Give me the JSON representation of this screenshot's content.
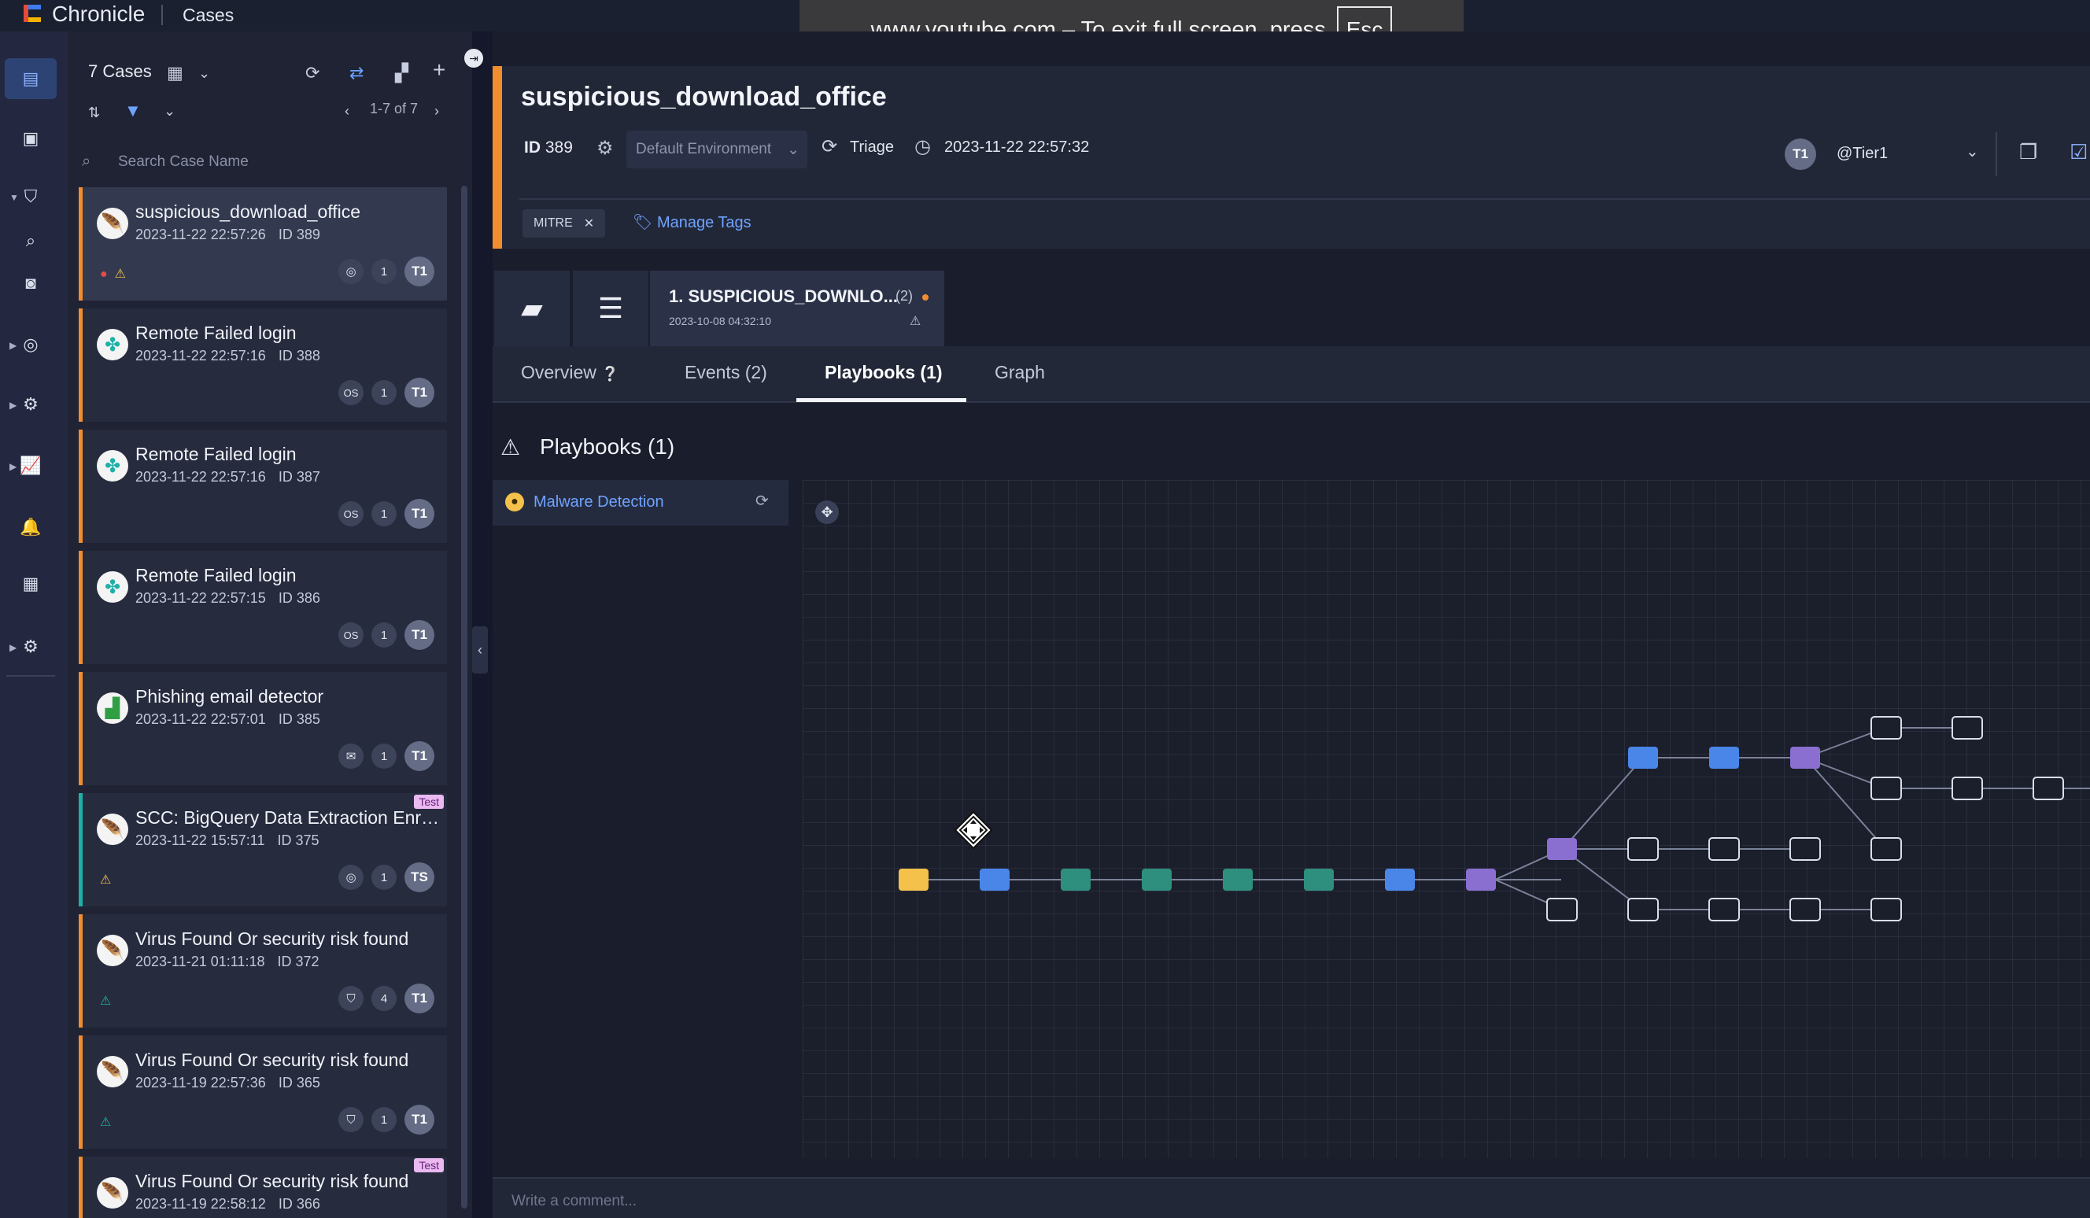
{
  "app": {
    "name": "Chronicle",
    "section": "Cases"
  },
  "browser_toast": {
    "text": "www.youtube.com – To exit full screen, press",
    "key": "Esc"
  },
  "rail": {
    "items": [
      "cases-icon",
      "briefcase-icon",
      "shield-icon",
      "search-icon",
      "camera-icon",
      "radar-icon",
      "gear-icon",
      "chart-icon",
      "bell-icon",
      "store-icon",
      "settings-icon"
    ]
  },
  "case_list": {
    "count_label": "7 Cases",
    "pager": "1-7 of 7",
    "search_placeholder": "Search Case Name",
    "cases": [
      {
        "title": "suspicious_download_office",
        "time": "2023-11-22 22:57:26",
        "id": "ID 389",
        "badge_mid": "1",
        "tier": "T1",
        "selected": true
      },
      {
        "title": "Remote Failed login",
        "time": "2023-11-22 22:57:16",
        "id": "ID 388",
        "badge_os": "OS",
        "badge_mid": "1",
        "tier": "T1"
      },
      {
        "title": "Remote Failed login",
        "time": "2023-11-22 22:57:16",
        "id": "ID 387",
        "badge_os": "OS",
        "badge_mid": "1",
        "tier": "T1"
      },
      {
        "title": "Remote Failed login",
        "time": "2023-11-22 22:57:15",
        "id": "ID 386",
        "badge_os": "OS",
        "badge_mid": "1",
        "tier": "T1"
      },
      {
        "title": "Phishing email detector",
        "time": "2023-11-22 22:57:01",
        "id": "ID 385",
        "badge_mid": "1",
        "tier": "T1"
      },
      {
        "title": "SCC: BigQuery Data Extraction Enrichment",
        "time": "2023-11-22 15:57:11",
        "id": "ID 375",
        "badge_mid": "1",
        "tier": "TS",
        "test": "Test"
      },
      {
        "title": "Virus Found Or security risk found",
        "time": "2023-11-21 01:11:18",
        "id": "ID 372",
        "badge_mid": "4",
        "tier": "T1"
      },
      {
        "title": "Virus Found Or security risk found",
        "time": "2023-11-19 22:57:36",
        "id": "ID 365",
        "badge_mid": "1",
        "tier": "T1"
      },
      {
        "title": "Virus Found Or security risk found",
        "time": "2023-11-19 22:58:12",
        "id": "ID 366",
        "test": "Test"
      }
    ]
  },
  "case": {
    "name": "suspicious_download_office",
    "id_label": "ID",
    "id_value": "389",
    "environment": "Default Environment",
    "stage": "Triage",
    "time": "2023-11-22 22:57:32",
    "assignee_avatar": "T1",
    "assignee": "@Tier1",
    "tag": "MITRE",
    "manage_tags": "Manage Tags"
  },
  "alert": {
    "title": "1. SUSPICIOUS_DOWNLO...",
    "count": "(2)",
    "time": "2023-10-08 04:32:10"
  },
  "tabs": [
    {
      "label": "Overview"
    },
    {
      "label": "Events (2)"
    },
    {
      "label": "Playbooks (1)"
    },
    {
      "label": "Graph"
    }
  ],
  "playbooks": {
    "heading": "Playbooks (1)",
    "items": [
      {
        "label": "Malware Detection"
      }
    ]
  },
  "comment": {
    "placeholder": "Write a comment..."
  },
  "colors": {
    "accent": "#f28d2f",
    "link": "#6ea3ff",
    "teal": "#1fb1a8",
    "node_blue": "#4a86e8",
    "node_green": "#2f8f7f",
    "node_purple": "#8a6fd1",
    "node_yellow": "#f4c14a"
  }
}
